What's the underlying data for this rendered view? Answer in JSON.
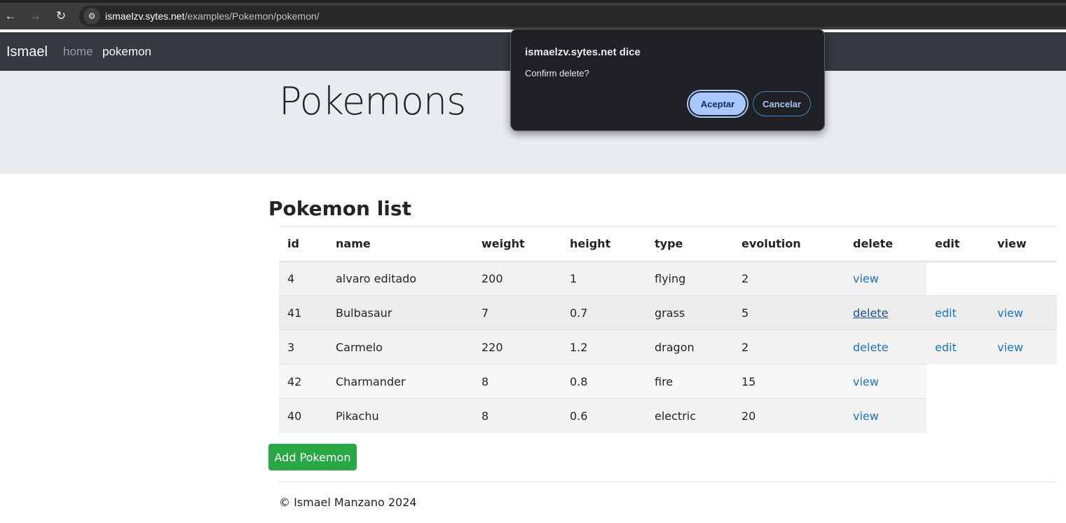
{
  "browser": {
    "url_host": "ismaelzv.sytes.net",
    "url_path": "/examples/Pokemon/pokemon/",
    "back_icon": "←",
    "forward_icon": "→",
    "reload_icon": "↻",
    "site_info_icon": "⚙"
  },
  "navbar": {
    "brand": "Ismael",
    "links": [
      {
        "label": "home",
        "active": false
      },
      {
        "label": "pokemon",
        "active": true
      }
    ]
  },
  "jumbotron": {
    "title": "Pokemons"
  },
  "main": {
    "title": "Pokemon list",
    "table": {
      "headers": [
        "id",
        "name",
        "weight",
        "height",
        "type",
        "evolution",
        "delete",
        "edit",
        "view"
      ],
      "rows": [
        {
          "id": "4",
          "name": "alvaro editado",
          "weight": "200",
          "height": "1",
          "type": "flying",
          "evolution": "2",
          "actions": [
            "view"
          ]
        },
        {
          "id": "41",
          "name": "Bulbasaur",
          "weight": "7",
          "height": "0.7",
          "type": "grass",
          "evolution": "5",
          "actions": [
            "delete",
            "edit",
            "view"
          ]
        },
        {
          "id": "3",
          "name": "Carmelo",
          "weight": "220",
          "height": "1.2",
          "type": "dragon",
          "evolution": "2",
          "actions": [
            "delete",
            "edit",
            "view"
          ]
        },
        {
          "id": "42",
          "name": "Charmander",
          "weight": "8",
          "height": "0.8",
          "type": "fire",
          "evolution": "15",
          "actions": [
            "view"
          ]
        },
        {
          "id": "40",
          "name": "Pikachu",
          "weight": "8",
          "height": "0.6",
          "type": "electric",
          "evolution": "20",
          "actions": [
            "view"
          ]
        }
      ]
    },
    "add_button": "Add Pokemon"
  },
  "footer": {
    "text": "© Ismael Manzano 2024"
  },
  "dialog": {
    "title": "ismaelzv.sytes.net dice",
    "message": "Confirm delete?",
    "accept_label": "Aceptar",
    "cancel_label": "Cancelar"
  },
  "colors": {
    "navbar": "#343a40",
    "jumbotron": "#e9ecef",
    "link": "#1a73c8",
    "success": "#28a745",
    "dialog_bg": "#202124",
    "dialog_accent": "#a8c7fa"
  }
}
